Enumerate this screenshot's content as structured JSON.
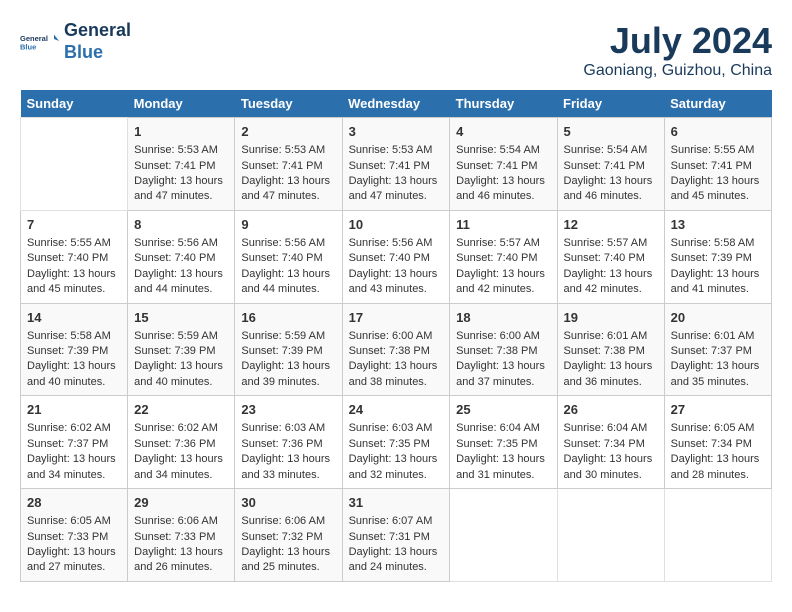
{
  "header": {
    "logo_line1": "General",
    "logo_line2": "Blue",
    "month_year": "July 2024",
    "location": "Gaoniang, Guizhou, China"
  },
  "weekdays": [
    "Sunday",
    "Monday",
    "Tuesday",
    "Wednesday",
    "Thursday",
    "Friday",
    "Saturday"
  ],
  "weeks": [
    [
      {
        "day": "",
        "sunrise": "",
        "sunset": "",
        "daylight": ""
      },
      {
        "day": "1",
        "sunrise": "Sunrise: 5:53 AM",
        "sunset": "Sunset: 7:41 PM",
        "daylight": "Daylight: 13 hours and 47 minutes."
      },
      {
        "day": "2",
        "sunrise": "Sunrise: 5:53 AM",
        "sunset": "Sunset: 7:41 PM",
        "daylight": "Daylight: 13 hours and 47 minutes."
      },
      {
        "day": "3",
        "sunrise": "Sunrise: 5:53 AM",
        "sunset": "Sunset: 7:41 PM",
        "daylight": "Daylight: 13 hours and 47 minutes."
      },
      {
        "day": "4",
        "sunrise": "Sunrise: 5:54 AM",
        "sunset": "Sunset: 7:41 PM",
        "daylight": "Daylight: 13 hours and 46 minutes."
      },
      {
        "day": "5",
        "sunrise": "Sunrise: 5:54 AM",
        "sunset": "Sunset: 7:41 PM",
        "daylight": "Daylight: 13 hours and 46 minutes."
      },
      {
        "day": "6",
        "sunrise": "Sunrise: 5:55 AM",
        "sunset": "Sunset: 7:41 PM",
        "daylight": "Daylight: 13 hours and 45 minutes."
      }
    ],
    [
      {
        "day": "7",
        "sunrise": "Sunrise: 5:55 AM",
        "sunset": "Sunset: 7:40 PM",
        "daylight": "Daylight: 13 hours and 45 minutes."
      },
      {
        "day": "8",
        "sunrise": "Sunrise: 5:56 AM",
        "sunset": "Sunset: 7:40 PM",
        "daylight": "Daylight: 13 hours and 44 minutes."
      },
      {
        "day": "9",
        "sunrise": "Sunrise: 5:56 AM",
        "sunset": "Sunset: 7:40 PM",
        "daylight": "Daylight: 13 hours and 44 minutes."
      },
      {
        "day": "10",
        "sunrise": "Sunrise: 5:56 AM",
        "sunset": "Sunset: 7:40 PM",
        "daylight": "Daylight: 13 hours and 43 minutes."
      },
      {
        "day": "11",
        "sunrise": "Sunrise: 5:57 AM",
        "sunset": "Sunset: 7:40 PM",
        "daylight": "Daylight: 13 hours and 42 minutes."
      },
      {
        "day": "12",
        "sunrise": "Sunrise: 5:57 AM",
        "sunset": "Sunset: 7:40 PM",
        "daylight": "Daylight: 13 hours and 42 minutes."
      },
      {
        "day": "13",
        "sunrise": "Sunrise: 5:58 AM",
        "sunset": "Sunset: 7:39 PM",
        "daylight": "Daylight: 13 hours and 41 minutes."
      }
    ],
    [
      {
        "day": "14",
        "sunrise": "Sunrise: 5:58 AM",
        "sunset": "Sunset: 7:39 PM",
        "daylight": "Daylight: 13 hours and 40 minutes."
      },
      {
        "day": "15",
        "sunrise": "Sunrise: 5:59 AM",
        "sunset": "Sunset: 7:39 PM",
        "daylight": "Daylight: 13 hours and 40 minutes."
      },
      {
        "day": "16",
        "sunrise": "Sunrise: 5:59 AM",
        "sunset": "Sunset: 7:39 PM",
        "daylight": "Daylight: 13 hours and 39 minutes."
      },
      {
        "day": "17",
        "sunrise": "Sunrise: 6:00 AM",
        "sunset": "Sunset: 7:38 PM",
        "daylight": "Daylight: 13 hours and 38 minutes."
      },
      {
        "day": "18",
        "sunrise": "Sunrise: 6:00 AM",
        "sunset": "Sunset: 7:38 PM",
        "daylight": "Daylight: 13 hours and 37 minutes."
      },
      {
        "day": "19",
        "sunrise": "Sunrise: 6:01 AM",
        "sunset": "Sunset: 7:38 PM",
        "daylight": "Daylight: 13 hours and 36 minutes."
      },
      {
        "day": "20",
        "sunrise": "Sunrise: 6:01 AM",
        "sunset": "Sunset: 7:37 PM",
        "daylight": "Daylight: 13 hours and 35 minutes."
      }
    ],
    [
      {
        "day": "21",
        "sunrise": "Sunrise: 6:02 AM",
        "sunset": "Sunset: 7:37 PM",
        "daylight": "Daylight: 13 hours and 34 minutes."
      },
      {
        "day": "22",
        "sunrise": "Sunrise: 6:02 AM",
        "sunset": "Sunset: 7:36 PM",
        "daylight": "Daylight: 13 hours and 34 minutes."
      },
      {
        "day": "23",
        "sunrise": "Sunrise: 6:03 AM",
        "sunset": "Sunset: 7:36 PM",
        "daylight": "Daylight: 13 hours and 33 minutes."
      },
      {
        "day": "24",
        "sunrise": "Sunrise: 6:03 AM",
        "sunset": "Sunset: 7:35 PM",
        "daylight": "Daylight: 13 hours and 32 minutes."
      },
      {
        "day": "25",
        "sunrise": "Sunrise: 6:04 AM",
        "sunset": "Sunset: 7:35 PM",
        "daylight": "Daylight: 13 hours and 31 minutes."
      },
      {
        "day": "26",
        "sunrise": "Sunrise: 6:04 AM",
        "sunset": "Sunset: 7:34 PM",
        "daylight": "Daylight: 13 hours and 30 minutes."
      },
      {
        "day": "27",
        "sunrise": "Sunrise: 6:05 AM",
        "sunset": "Sunset: 7:34 PM",
        "daylight": "Daylight: 13 hours and 28 minutes."
      }
    ],
    [
      {
        "day": "28",
        "sunrise": "Sunrise: 6:05 AM",
        "sunset": "Sunset: 7:33 PM",
        "daylight": "Daylight: 13 hours and 27 minutes."
      },
      {
        "day": "29",
        "sunrise": "Sunrise: 6:06 AM",
        "sunset": "Sunset: 7:33 PM",
        "daylight": "Daylight: 13 hours and 26 minutes."
      },
      {
        "day": "30",
        "sunrise": "Sunrise: 6:06 AM",
        "sunset": "Sunset: 7:32 PM",
        "daylight": "Daylight: 13 hours and 25 minutes."
      },
      {
        "day": "31",
        "sunrise": "Sunrise: 6:07 AM",
        "sunset": "Sunset: 7:31 PM",
        "daylight": "Daylight: 13 hours and 24 minutes."
      },
      {
        "day": "",
        "sunrise": "",
        "sunset": "",
        "daylight": ""
      },
      {
        "day": "",
        "sunrise": "",
        "sunset": "",
        "daylight": ""
      },
      {
        "day": "",
        "sunrise": "",
        "sunset": "",
        "daylight": ""
      }
    ]
  ]
}
